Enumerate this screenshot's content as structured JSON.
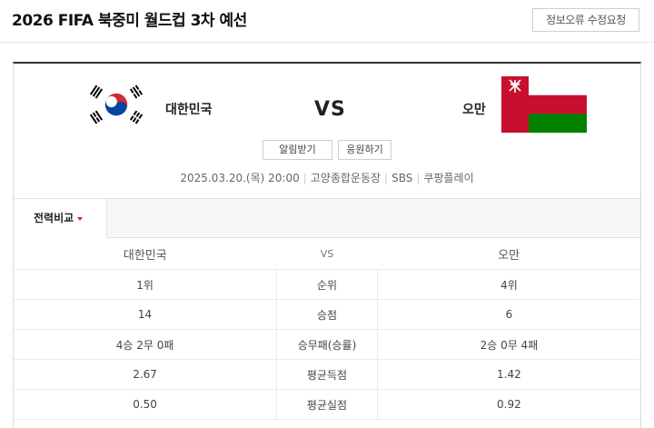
{
  "page": {
    "title": "2026 FIFA 북중미 월드컵 3차 예선",
    "report_button": "정보오류 수정요청"
  },
  "match": {
    "home": "대한민국",
    "away": "오만",
    "vs": "VS",
    "buttons": {
      "alarm": "알림받기",
      "cheer": "응원하기"
    },
    "info": {
      "datetime": "2025.03.20.(목) 20:00",
      "venue": "고양종합운동장",
      "broadcast1": "SBS",
      "broadcast2": "쿠팡플레이"
    }
  },
  "tabs": {
    "active": "전력비교"
  },
  "stats": {
    "header": {
      "home": "대한민국",
      "mid": "VS",
      "away": "오만"
    },
    "rows": [
      {
        "home": "1위",
        "label": "순위",
        "away": "4위"
      },
      {
        "home": "14",
        "label": "승점",
        "away": "6"
      },
      {
        "home": "4승 2무 0패",
        "label": "승무패(승률)",
        "away": "2승 0무 4패"
      },
      {
        "home": "2.67",
        "label": "평균득점",
        "away": "1.42"
      },
      {
        "home": "0.50",
        "label": "평균실점",
        "away": "0.92"
      }
    ]
  },
  "colors": {
    "korea_red": "#cd2e3a",
    "korea_blue": "#0047a0",
    "oman_red": "#c8102e",
    "oman_green": "#008000",
    "tab_caret": "#e2231a"
  }
}
